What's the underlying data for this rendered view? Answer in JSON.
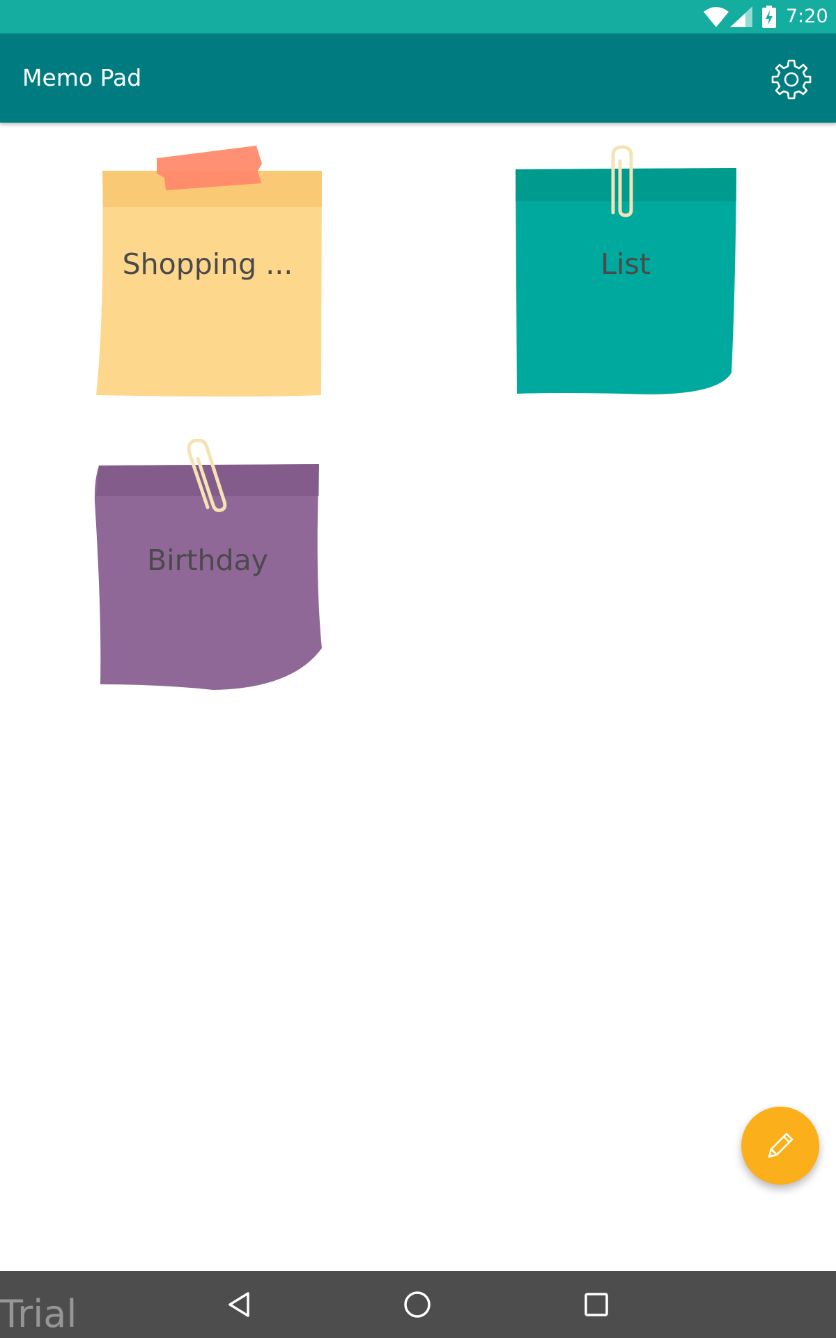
{
  "status_bar": {
    "time": "7:20",
    "icons": [
      "wifi-icon",
      "cell-signal-icon",
      "battery-charging-icon"
    ],
    "color": "#15ada0"
  },
  "app_bar": {
    "title": "Memo Pad",
    "action_icon": "gear-icon",
    "color": "#007c80"
  },
  "notes": [
    {
      "title": "Shopping ...",
      "color": "#fdd78c",
      "fastener": "tape-icon"
    },
    {
      "title": "List",
      "color": "#00a99d",
      "fastener": "paperclip-icon"
    },
    {
      "title": "Birthday",
      "color": "#8f6897",
      "fastener": "paperclip-icon"
    }
  ],
  "fab": {
    "icon": "pencil-icon",
    "color": "#fbaf1a"
  },
  "nav_bar": {
    "buttons": [
      "back-icon",
      "home-icon",
      "recents-icon"
    ],
    "color": "#4d4d4d"
  },
  "watermark": {
    "text": "Trial"
  }
}
